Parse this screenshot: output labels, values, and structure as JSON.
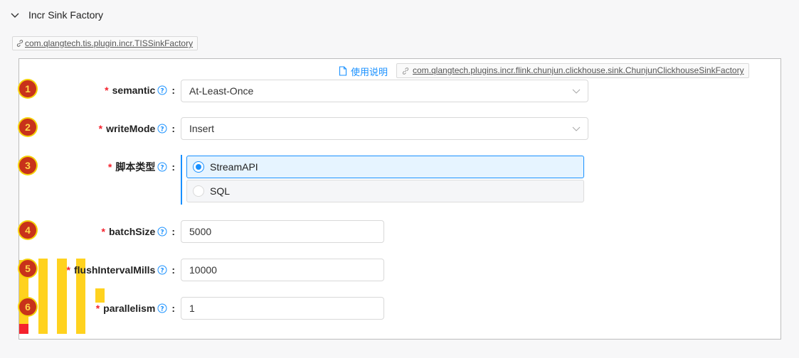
{
  "panel": {
    "title": "Incr Sink Factory"
  },
  "plugin_tag": "com.qlangtech.tis.plugin.incr.TISSinkFactory",
  "doc_link": "使用说明",
  "impl_tag": "com.qlangtech.plugins.incr.flink.chunjun.clickhouse.sink.ChunjunClickhouseSinkFactory",
  "steps": [
    "1",
    "2",
    "3",
    "4",
    "5",
    "6"
  ],
  "fields": {
    "semantic": {
      "label": "semantic",
      "value": "At-Least-Once"
    },
    "writeMode": {
      "label": "writeMode",
      "value": "Insert"
    },
    "scriptType": {
      "label": "脚本类型",
      "options": [
        "StreamAPI",
        "SQL"
      ],
      "selected": "StreamAPI"
    },
    "batchSize": {
      "label": "batchSize",
      "value": "5000"
    },
    "flushIntervalMills": {
      "label": "flushIntervalMills",
      "value": "10000"
    },
    "parallelism": {
      "label": "parallelism",
      "value": "1"
    }
  },
  "required_mark": "*",
  "colon": ":",
  "colors": {
    "accent": "#1890ff",
    "required": "#f5222d",
    "step": "#c8321a"
  }
}
